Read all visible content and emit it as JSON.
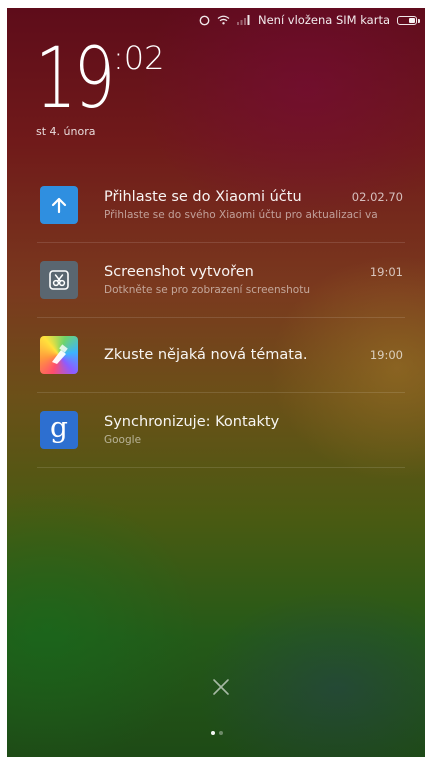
{
  "status_bar": {
    "carrier_text": "Není vložena SIM karta",
    "icons": [
      "alarm-icon",
      "wifi-icon",
      "signal-icon",
      "battery-icon"
    ],
    "battery_level": 0.45
  },
  "lock_screen": {
    "clock_hour": "19",
    "clock_minute": ":02",
    "date": "st 4. února"
  },
  "notifications": [
    {
      "icon": "upload-arrow-icon",
      "title": "Přihlaste se do Xiaomi účtu",
      "subtitle": "Přihlaste se do svého Xiaomi účtu pro aktualizaci va",
      "time": "02.02.70"
    },
    {
      "icon": "screenshot-scissors-icon",
      "title": "Screenshot vytvořen",
      "subtitle": "Dotkněte se pro zobrazení screenshotu",
      "time": "19:01"
    },
    {
      "icon": "themes-brush-icon",
      "title": "Zkuste nějaká nová témata.",
      "subtitle": "",
      "time": "19:00"
    },
    {
      "icon": "google-sync-icon",
      "title": "Synchronizuje: Kontakty",
      "subtitle": "Google",
      "time": ""
    }
  ],
  "controls": {
    "dismiss_icon": "close-icon",
    "page_count": 2,
    "active_page": 1
  },
  "colors": {
    "account_icon_bg": "#2f8fe0",
    "screenshot_icon_bg": "#5a6670",
    "google_icon_bg": "#2d6fd0"
  }
}
